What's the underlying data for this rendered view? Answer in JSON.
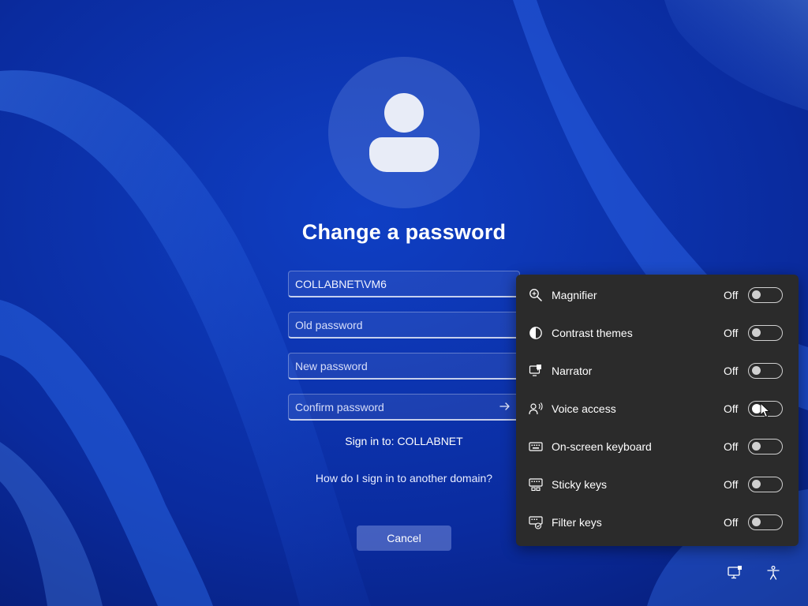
{
  "login": {
    "title": "Change a password",
    "username_value": "COLLABNET\\VM6",
    "old_password_placeholder": "Old password",
    "new_password_placeholder": "New password",
    "confirm_password_placeholder": "Confirm password",
    "sign_in_to": "Sign in to: COLLABNET",
    "other_domain_link": "How do I sign in to another domain?",
    "cancel_label": "Cancel"
  },
  "accessibility_panel": {
    "items": [
      {
        "label": "Magnifier",
        "state": "Off",
        "icon": "magnifier-icon"
      },
      {
        "label": "Contrast themes",
        "state": "Off",
        "icon": "contrast-icon"
      },
      {
        "label": "Narrator",
        "state": "Off",
        "icon": "narrator-icon"
      },
      {
        "label": "Voice access",
        "state": "Off",
        "icon": "voice-access-icon"
      },
      {
        "label": "On-screen keyboard",
        "state": "Off",
        "icon": "keyboard-icon"
      },
      {
        "label": "Sticky keys",
        "state": "Off",
        "icon": "sticky-keys-icon"
      },
      {
        "label": "Filter keys",
        "state": "Off",
        "icon": "filter-keys-icon"
      }
    ]
  },
  "tray": {
    "icons": [
      "network-display-icon",
      "accessibility-icon"
    ]
  },
  "colors": {
    "background": "#0a2a9c",
    "panel": "#2b2b2b",
    "text": "#ffffff"
  }
}
